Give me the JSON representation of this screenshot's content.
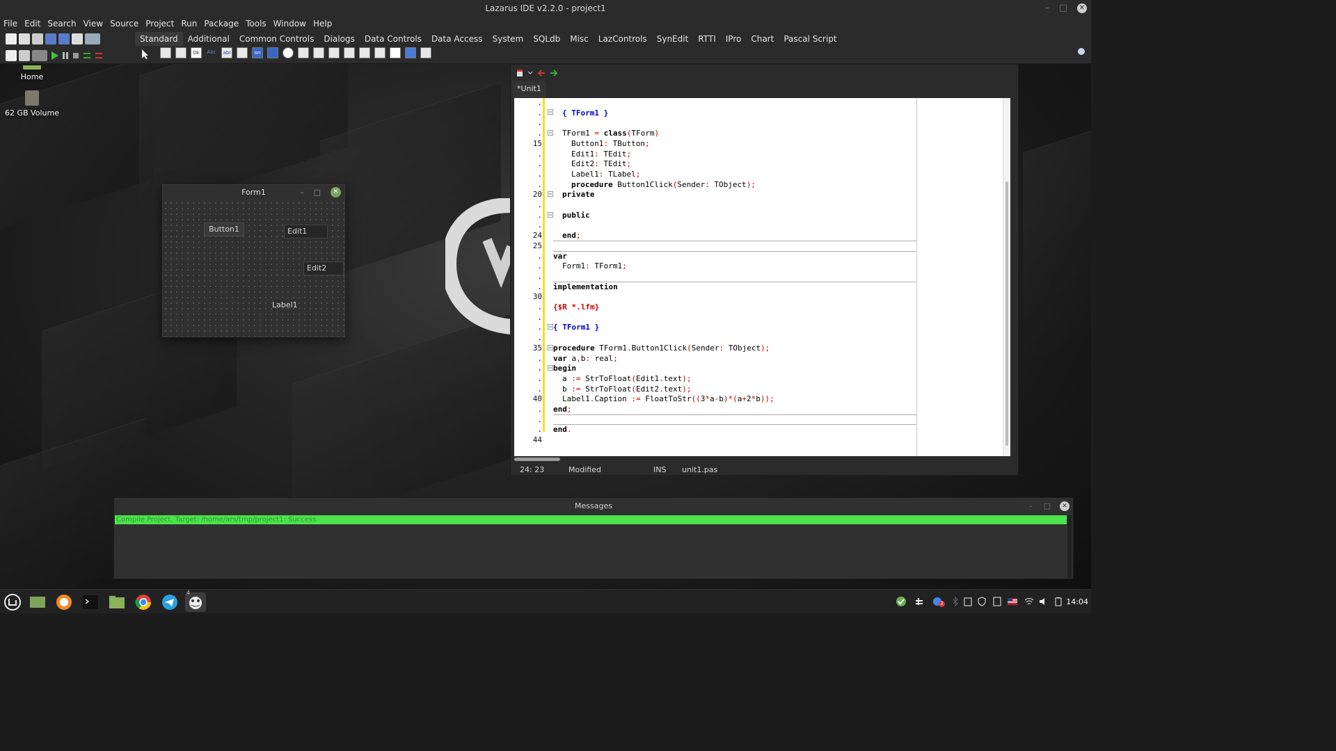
{
  "window": {
    "title": "Lazarus IDE v2.2.0 - project1",
    "minimize": "–",
    "maximize": "□",
    "close": "✕"
  },
  "menu": [
    "File",
    "Edit",
    "Search",
    "View",
    "Source",
    "Project",
    "Run",
    "Package",
    "Tools",
    "Window",
    "Help"
  ],
  "palette_tabs": [
    "Standard",
    "Additional",
    "Common Controls",
    "Dialogs",
    "Data Controls",
    "Data Access",
    "System",
    "SQLdb",
    "Misc",
    "LazControls",
    "SynEdit",
    "RTTI",
    "IPro",
    "Chart",
    "Pascal Script"
  ],
  "palette_components": [
    "TMainMenu",
    "TPopupMenu",
    "TButton",
    "TLabel",
    "TEdit",
    "TMemo",
    "TToggleBox",
    "TCheckBox",
    "TRadioButton",
    "TListBox",
    "TComboBox",
    "TScrollBar",
    "TGroupBox",
    "TRadioGroup",
    "TCheckGroup",
    "TPanel",
    "TFrame",
    "TActionList"
  ],
  "palette_glyphs": {
    "ok": "Ok",
    "abc": "Abc",
    "abi": "abI",
    "on": "on"
  },
  "desktop_icons": [
    {
      "label": "Home"
    },
    {
      "label": "62 GB Volume"
    }
  ],
  "form1": {
    "title": "Form1",
    "button1": "Button1",
    "edit1": "Edit1",
    "edit2": "Edit2",
    "label1": "Label1"
  },
  "editor": {
    "tab": "*Unit1",
    "status": {
      "position": "24: 23",
      "state": "Modified",
      "mode": "INS",
      "file": "unit1.pas"
    }
  },
  "messages": {
    "title": "Messages",
    "line": "Compile Project, Target: /home/ars/tmp/project1: Success"
  },
  "taskbar": {
    "clock": "14:04",
    "badge": "4",
    "tray_badge": "2"
  },
  "colors": {
    "success": "#4be24b",
    "comment": "#0000cc",
    "directive": "#d00000",
    "change_bar": "#f4e11a"
  }
}
